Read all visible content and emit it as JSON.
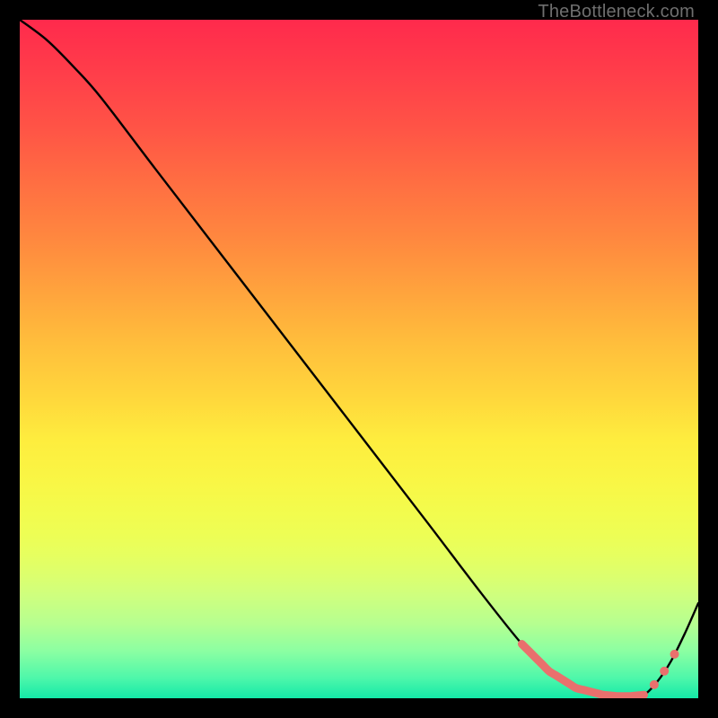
{
  "attribution": "TheBottleneck.com",
  "colors": {
    "curve": "#000000",
    "highlight": "#e9706d",
    "gradient_top": "#ff2a4c",
    "gradient_bottom": "#14e9a8"
  },
  "chart_data": {
    "type": "line",
    "title": "",
    "xlabel": "",
    "ylabel": "",
    "xlim": [
      0,
      100
    ],
    "ylim": [
      0,
      100
    ],
    "x": [
      0,
      4,
      8,
      12,
      20,
      30,
      40,
      50,
      60,
      68,
      74,
      78,
      82,
      86,
      88,
      90,
      92,
      94,
      96,
      98,
      100
    ],
    "y": [
      100,
      97,
      93,
      88.5,
      78,
      65,
      52,
      39,
      26,
      15.5,
      8,
      4,
      1.5,
      0.5,
      0.3,
      0.3,
      0.5,
      2.5,
      5.5,
      9.5,
      14
    ],
    "highlight_range_x": [
      74,
      92
    ],
    "dot_points_x": [
      93.5,
      95,
      96.5
    ],
    "annotations": []
  }
}
